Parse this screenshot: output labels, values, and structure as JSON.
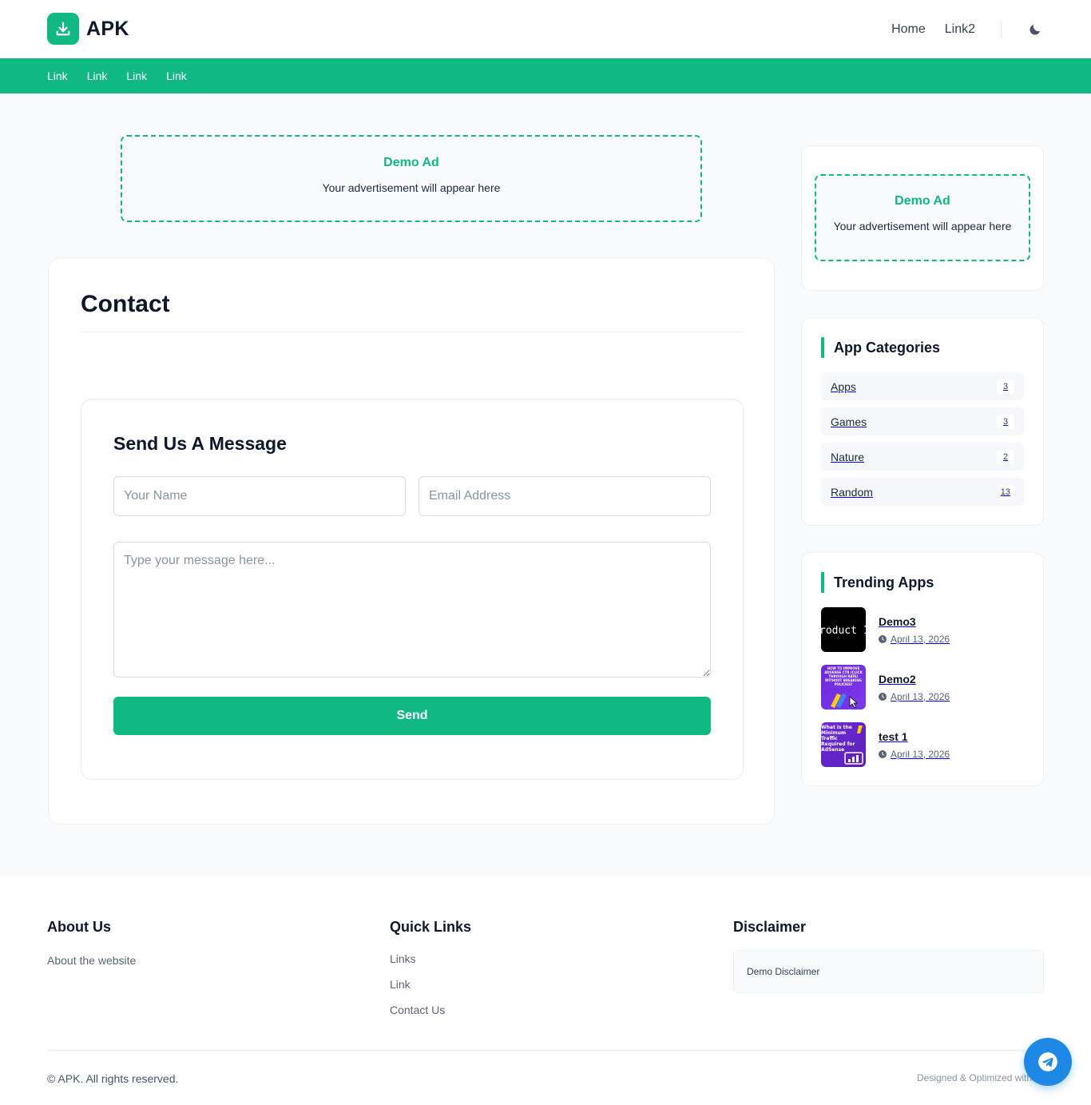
{
  "brand": {
    "name": "APK",
    "accent": "#10b981"
  },
  "header": {
    "nav": [
      "Home",
      "Link2"
    ],
    "theme_icon": "moon-icon"
  },
  "subnav": [
    "Link",
    "Link",
    "Link",
    "Link"
  ],
  "ads": {
    "main": {
      "title": "Demo Ad",
      "text": "Your advertisement will appear here"
    },
    "sidebar": {
      "title": "Demo Ad",
      "text": "Your advertisement will appear here"
    }
  },
  "contact": {
    "title": "Contact",
    "form": {
      "title": "Send Us A Message",
      "name_placeholder": "Your Name",
      "email_placeholder": "Email Address",
      "message_placeholder": "Type your message here...",
      "send_label": "Send"
    }
  },
  "sidebar": {
    "categories": {
      "title": "App Categories",
      "items": [
        {
          "name": "Apps",
          "count": "3"
        },
        {
          "name": "Games",
          "count": "3"
        },
        {
          "name": "Nature",
          "count": "2"
        },
        {
          "name": "Random",
          "count": "13"
        }
      ]
    },
    "trending": {
      "title": "Trending Apps",
      "items": [
        {
          "name": "Demo3",
          "date": "April 13, 2026",
          "thumb_text": "roduct 1"
        },
        {
          "name": "Demo2",
          "date": "April 13, 2026",
          "thumb_text": "HOW TO IMPROVE ADSENSE CTR (CLICK THROUGH RATE) WITHOUT BREAKING POLICIES?"
        },
        {
          "name": "test 1",
          "date": "April 13, 2026",
          "thumb_text": "What is the Minimum Traffic Required for AdSense Approval?"
        }
      ]
    }
  },
  "footer": {
    "about": {
      "title": "About Us",
      "text": "About the website"
    },
    "quick_links": {
      "title": "Quick Links",
      "links": [
        "Links",
        "Link",
        "Contact Us"
      ]
    },
    "disclaimer": {
      "title": "Disclaimer",
      "text": "Demo Disclaimer"
    },
    "copyright": "© APK. All rights reserved.",
    "designed": "Designed & Optimized with"
  },
  "floating": {
    "icon": "telegram-icon"
  }
}
